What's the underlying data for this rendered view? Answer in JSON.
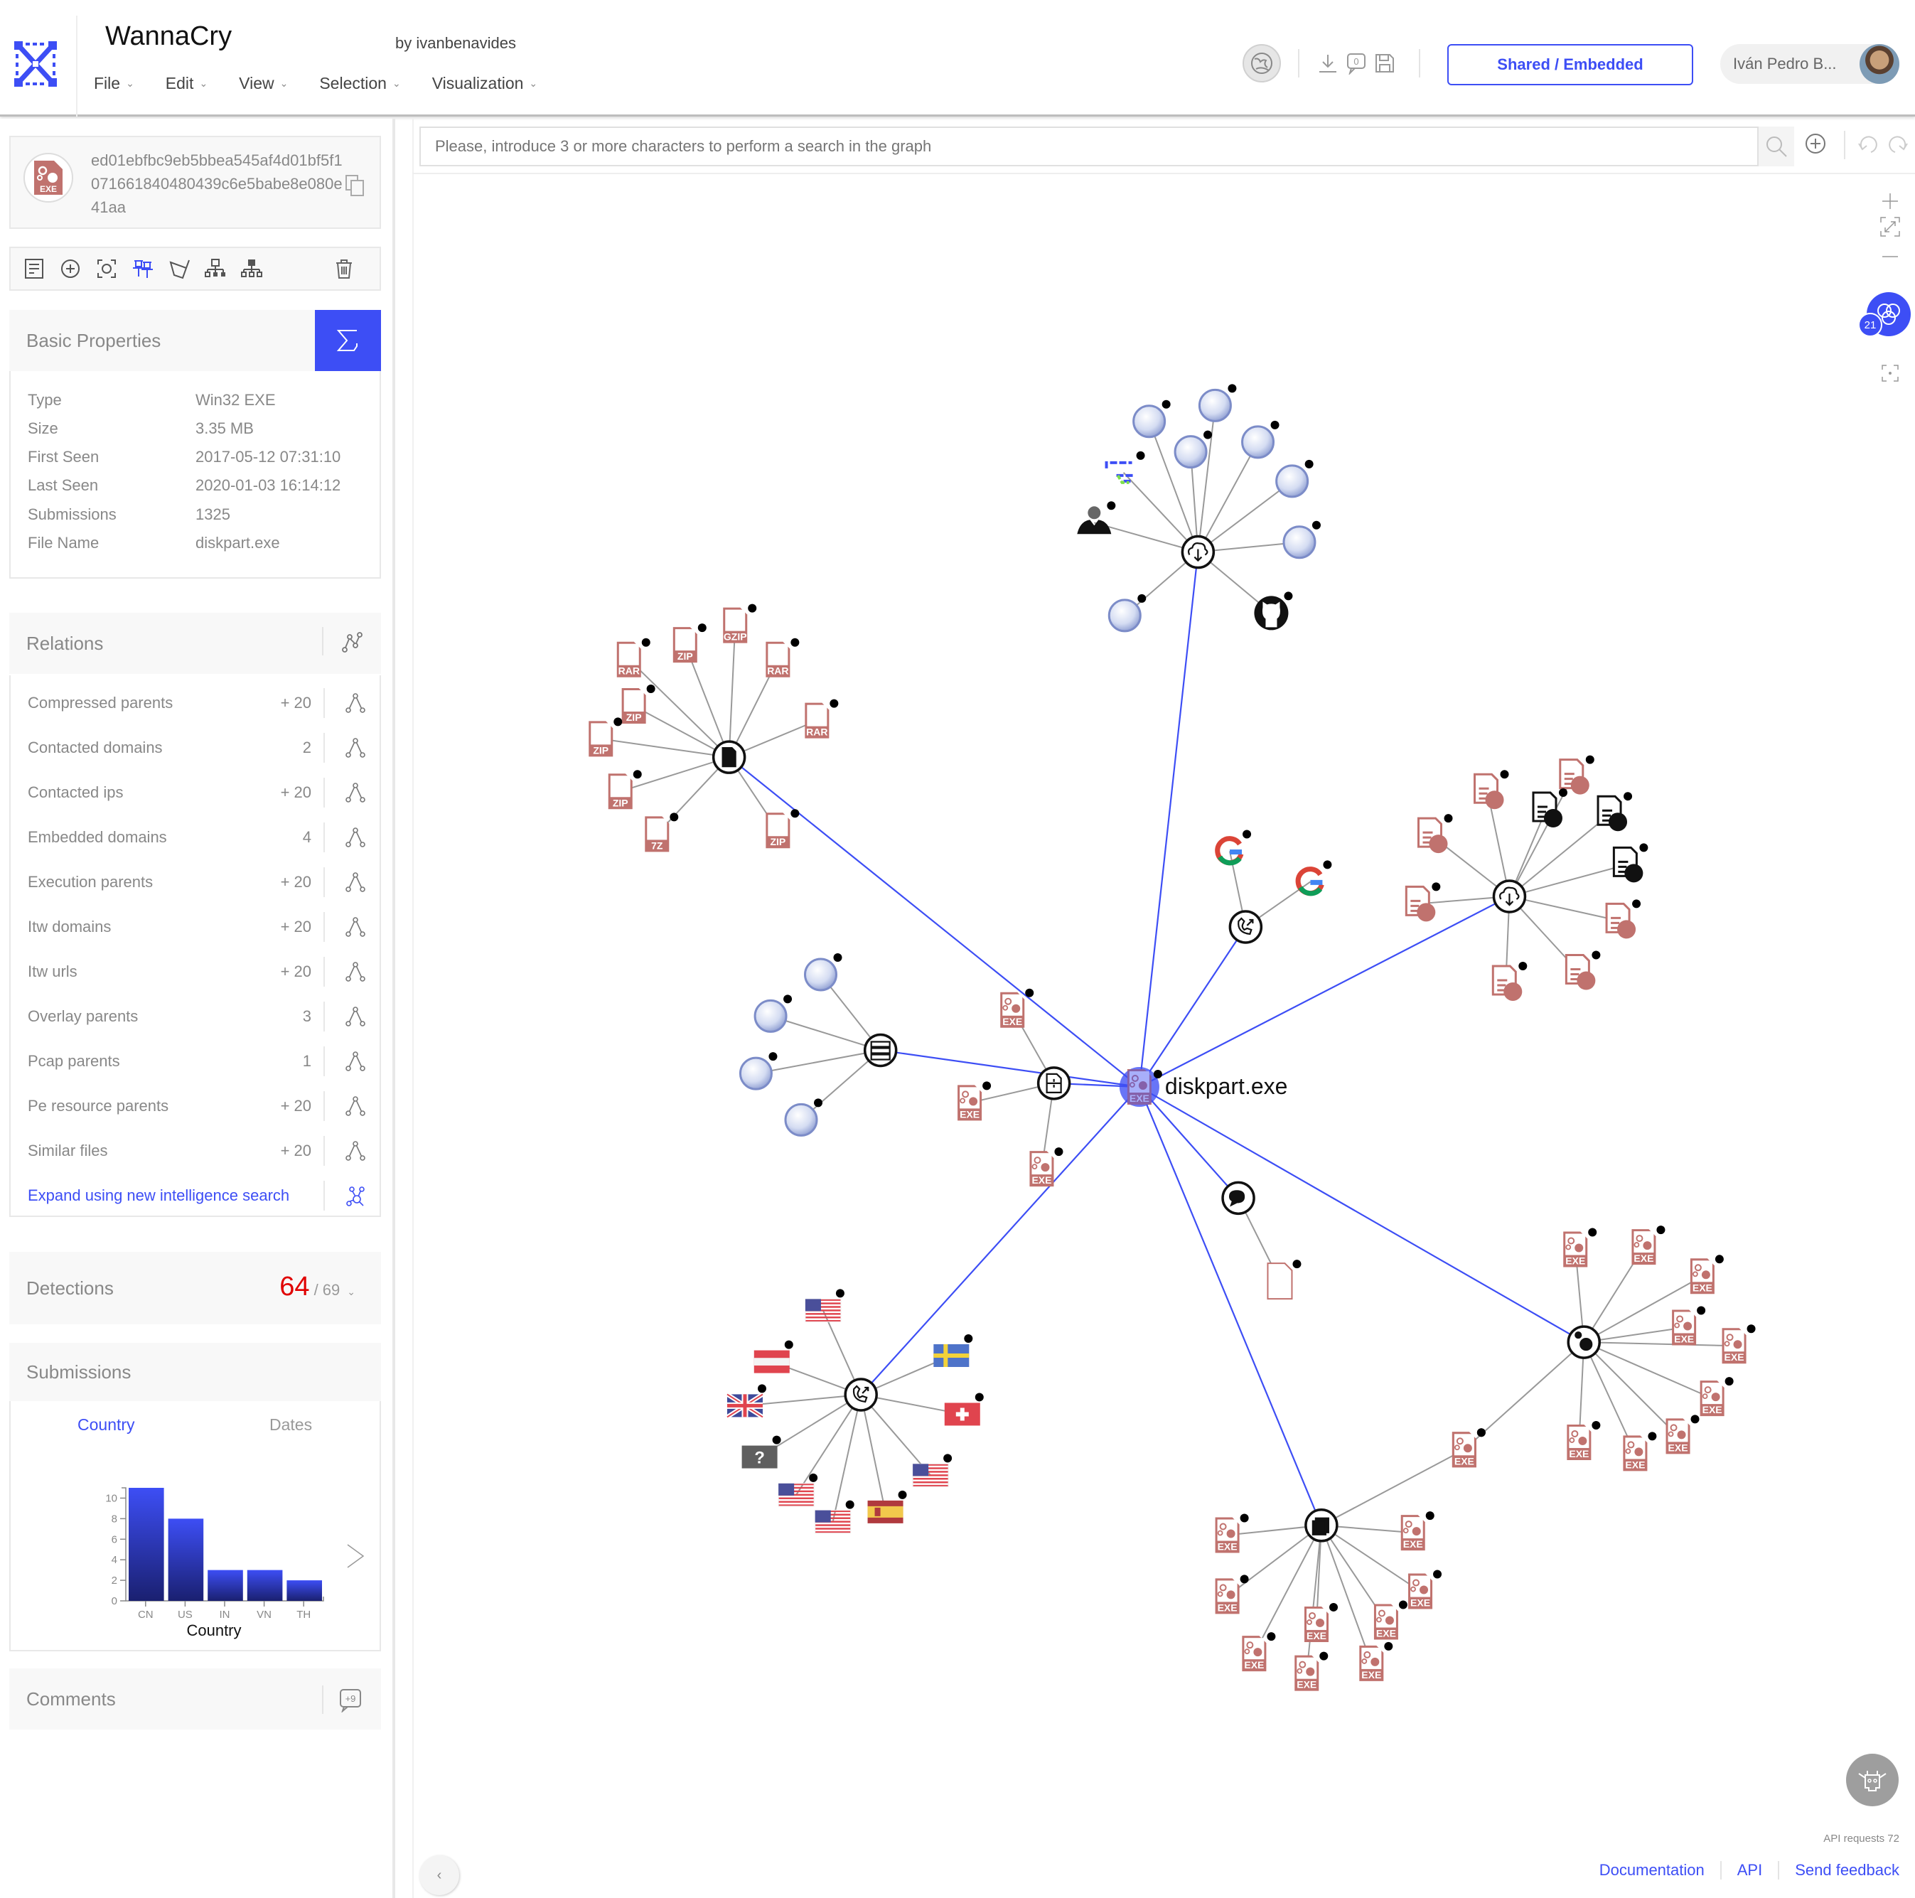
{
  "header": {
    "title": "WannaCry",
    "byline": "by ivanbenavides",
    "menu": [
      {
        "label": "File"
      },
      {
        "label": "Edit"
      },
      {
        "label": "View"
      },
      {
        "label": "Selection"
      },
      {
        "label": "Visualization"
      }
    ],
    "comment_count": "0",
    "shared_button": "Shared / Embedded",
    "user_name": "Iván Pedro B..."
  },
  "sidebar": {
    "hash": "ed01ebfbc9eb5bbea545af4d01bf5f1071661840480439c6e5babe8e080e41aa",
    "file_icon_label": "EXE",
    "basic_properties": {
      "title": "Basic Properties",
      "rows": [
        {
          "label": "Type",
          "value": "Win32 EXE"
        },
        {
          "label": "Size",
          "value": "3.35 MB"
        },
        {
          "label": "First Seen",
          "value": "2017-05-12 07:31:10"
        },
        {
          "label": "Last Seen",
          "value": "2020-01-03 16:14:12"
        },
        {
          "label": "Submissions",
          "value": "1325"
        },
        {
          "label": "File Name",
          "value": "diskpart.exe"
        }
      ]
    },
    "relations": {
      "title": "Relations",
      "rows": [
        {
          "label": "Compressed parents",
          "count": "+ 20"
        },
        {
          "label": "Contacted domains",
          "count": "2"
        },
        {
          "label": "Contacted ips",
          "count": "+ 20"
        },
        {
          "label": "Embedded domains",
          "count": "4"
        },
        {
          "label": "Execution parents",
          "count": "+ 20"
        },
        {
          "label": "Itw domains",
          "count": "+ 20"
        },
        {
          "label": "Itw urls",
          "count": "+ 20"
        },
        {
          "label": "Overlay parents",
          "count": "3"
        },
        {
          "label": "Pcap parents",
          "count": "1"
        },
        {
          "label": "Pe resource parents",
          "count": "+ 20"
        },
        {
          "label": "Similar files",
          "count": "+ 20"
        }
      ],
      "expand_link": "Expand using new intelligence search"
    },
    "detections": {
      "title": "Detections",
      "positives": "64",
      "total": "/ 69"
    },
    "submissions": {
      "title": "Submissions",
      "tabs": [
        {
          "label": "Country",
          "active": true
        },
        {
          "label": "Dates",
          "active": false
        }
      ]
    },
    "comments": {
      "title": "Comments",
      "badge": "+9"
    }
  },
  "chart_data": {
    "type": "bar",
    "categories": [
      "CN",
      "US",
      "IN",
      "VN",
      "TH"
    ],
    "values": [
      11,
      8,
      3,
      3,
      2
    ],
    "title": "",
    "xlabel": "Country",
    "ylabel": "",
    "ylim": [
      0,
      11
    ],
    "yticks": [
      0,
      2,
      4,
      6,
      8,
      10
    ],
    "grid": false,
    "bar_color_top": "#3d4ef5",
    "bar_color_bottom": "#1a2070"
  },
  "canvas": {
    "search_placeholder": "Please, introduce 3 or more characters to perform a search in the graph",
    "filter_badge": "21",
    "center_label": "diskpart.exe",
    "api_requests": "API requests 72",
    "footer_links": [
      "Documentation",
      "API",
      "Send feedback"
    ]
  },
  "colors": {
    "accent": "#3d4ef5",
    "malicious_file": "#c0726e",
    "detections_red": "#e00000"
  },
  "graph": {
    "hubs": [
      {
        "id": "compressed",
        "icon": "zip-file-icon",
        "children": [
          "RAR",
          "ZIP",
          "GZIP",
          "RAR",
          "RAR",
          "ZIP",
          "ZIP",
          "ZIP",
          "7Z",
          "ZIP"
        ]
      },
      {
        "id": "itw-urls",
        "icon": "cloud-download-icon",
        "children": [
          "globe",
          "globe",
          "globe",
          "globe",
          "globe",
          "globe",
          "github",
          "globe",
          "person",
          "banner"
        ]
      },
      {
        "id": "contacted-domains",
        "icon": "phone-call-icon",
        "children": [
          "google",
          "google"
        ]
      },
      {
        "id": "embedded-urls",
        "icon": "cloud-download-icon",
        "children": [
          "doc",
          "doc",
          "doc",
          "doc",
          "doc-black",
          "doc-black",
          "doc-black",
          "doc",
          "doc",
          "doc"
        ]
      },
      {
        "id": "itw-domains",
        "icon": "server-icon",
        "children": [
          "globe",
          "globe",
          "globe",
          "globe"
        ]
      },
      {
        "id": "overlay-parents",
        "icon": "overlay-file-icon",
        "children": [
          "EXE",
          "EXE",
          "EXE"
        ]
      },
      {
        "id": "pcap-parents",
        "icon": "chat-icon",
        "children": [
          "blank"
        ]
      },
      {
        "id": "contacted-ips",
        "icon": "phone-call-icon",
        "children": [
          "US",
          "AT",
          "GB",
          "unknown",
          "US",
          "US",
          "ES",
          "US",
          "CH",
          "SE"
        ]
      },
      {
        "id": "execution-parents",
        "icon": "gears-icon",
        "children": [
          "EXE",
          "EXE",
          "EXE",
          "EXE",
          "EXE",
          "EXE",
          "EXE",
          "EXE",
          "EXE",
          "EXE"
        ]
      },
      {
        "id": "pe-resource-parents",
        "icon": "stack-icon",
        "children": [
          "EXE",
          "EXE",
          "EXE",
          "EXE",
          "EXE",
          "EXE",
          "EXE",
          "EXE",
          "EXE",
          "EXE"
        ]
      }
    ]
  }
}
